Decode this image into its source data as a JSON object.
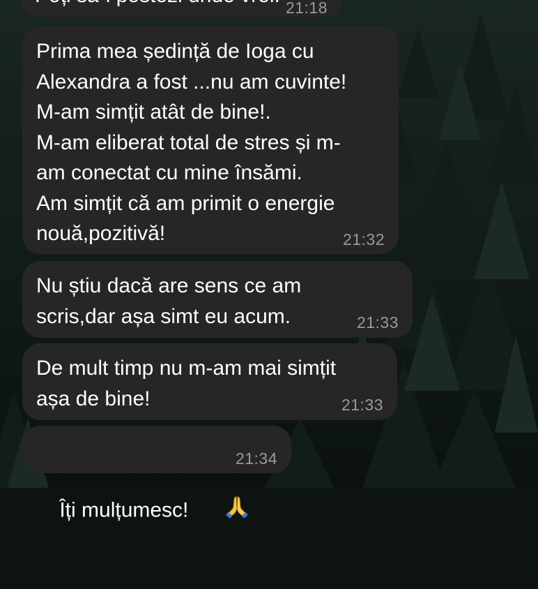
{
  "chat": {
    "messages": [
      {
        "text": "Poți să-l postezi unde vrei.",
        "time": "21:18"
      },
      {
        "text": "Prima mea ședință de Ioga cu\nAlexandra a fost ...nu am cuvinte!\nM-am simțit atât de bine!.\nM-am eliberat total de stres și m-\nam conectat cu mine însămi.\nAm simțit că am primit o energie\nnouă,pozitivă!",
        "time": "21:32"
      },
      {
        "text": "Nu știu dacă are sens ce am\nscris,dar așa simt eu acum.",
        "time": "21:33"
      },
      {
        "text": "De mult timp nu m-am mai simțit\nașa de bine!",
        "time": "21:33"
      },
      {
        "text": "Îți mulțumesc!",
        "time": "21:34",
        "emoji": "folded-hands-icon"
      }
    ]
  },
  "colors": {
    "bubble": "#262626",
    "text": "#ffffff",
    "timestamp": "#9a9a9a",
    "background": "#0d1410"
  }
}
